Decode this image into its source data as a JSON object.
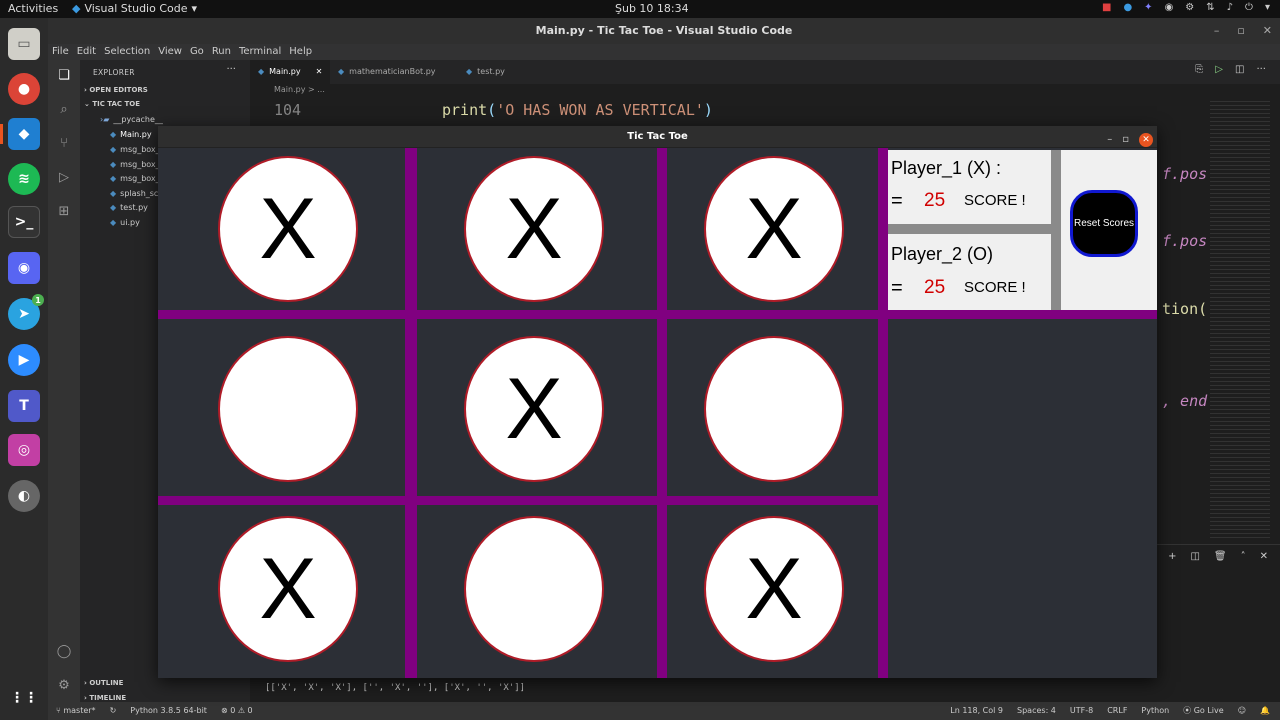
{
  "topbar": {
    "activities": "Activities",
    "app_name": "Visual Studio Code",
    "clock": "Şub 10  18:34"
  },
  "dock": {
    "items": [
      "files",
      "chrome",
      "vscode",
      "spotify",
      "terminal",
      "discord",
      "telegram",
      "zoom",
      "teams",
      "screenshot",
      "earth-pro"
    ],
    "telegram_badge": "1"
  },
  "vscode": {
    "window_title": "Main.py - Tic Tac Toe - Visual Studio Code",
    "menu": [
      "File",
      "Edit",
      "Selection",
      "View",
      "Go",
      "Run",
      "Terminal",
      "Help"
    ],
    "explorer": {
      "header": "EXPLORER",
      "open_editors": "OPEN EDITORS",
      "workspace": "TIC TAC TOE",
      "files": [
        "__pycache__",
        "Main.py",
        "msg_box_...",
        "msg_box_...",
        "msg_box_...",
        "splash_scr...",
        "test.py",
        "ui.py"
      ],
      "outline": "OUTLINE",
      "timeline": "TIMELINE"
    },
    "tabs": [
      "Main.py",
      "mathematicianBot.py",
      "test.py"
    ],
    "breadcrumb": "Main.py > ...",
    "editor": {
      "line_number": "104",
      "code_fn": "print",
      "code_open": "(",
      "code_str": "'O HAS WON AS VERTICAL'",
      "code_close": ")",
      "fragments": [
        "f.pos",
        "f.pos",
        "tion(",
        ", end"
      ]
    },
    "terminal_output": "[['X', 'X', 'X'], ['', 'X', ''], ['X', '', 'X']]",
    "status": {
      "branch": "master*",
      "python": "Python 3.8.5 64-bit",
      "problems": "⊗ 0 ⚠ 0",
      "position": "Ln 118, Col 9",
      "spaces": "Spaces: 4",
      "encoding": "UTF-8",
      "eol": "CRLF",
      "language": "Python",
      "golive": "Go Live"
    }
  },
  "game": {
    "window_title": "Tic Tac Toe",
    "board": [
      [
        "X",
        "X",
        "X"
      ],
      [
        "",
        "X",
        ""
      ],
      [
        "X",
        "",
        "X"
      ]
    ],
    "player1_label": "Player_1 (X) :",
    "player2_label": "Player_2 (O)",
    "equals": "=",
    "player1_score": "25",
    "player2_score": "25",
    "score_word": "SCORE !",
    "reset_label": "Reset Scores",
    "colors": {
      "grid": "#800080",
      "cell_border": "#b01c28",
      "score_value": "#d00000",
      "reset_border": "#1018d0"
    }
  }
}
